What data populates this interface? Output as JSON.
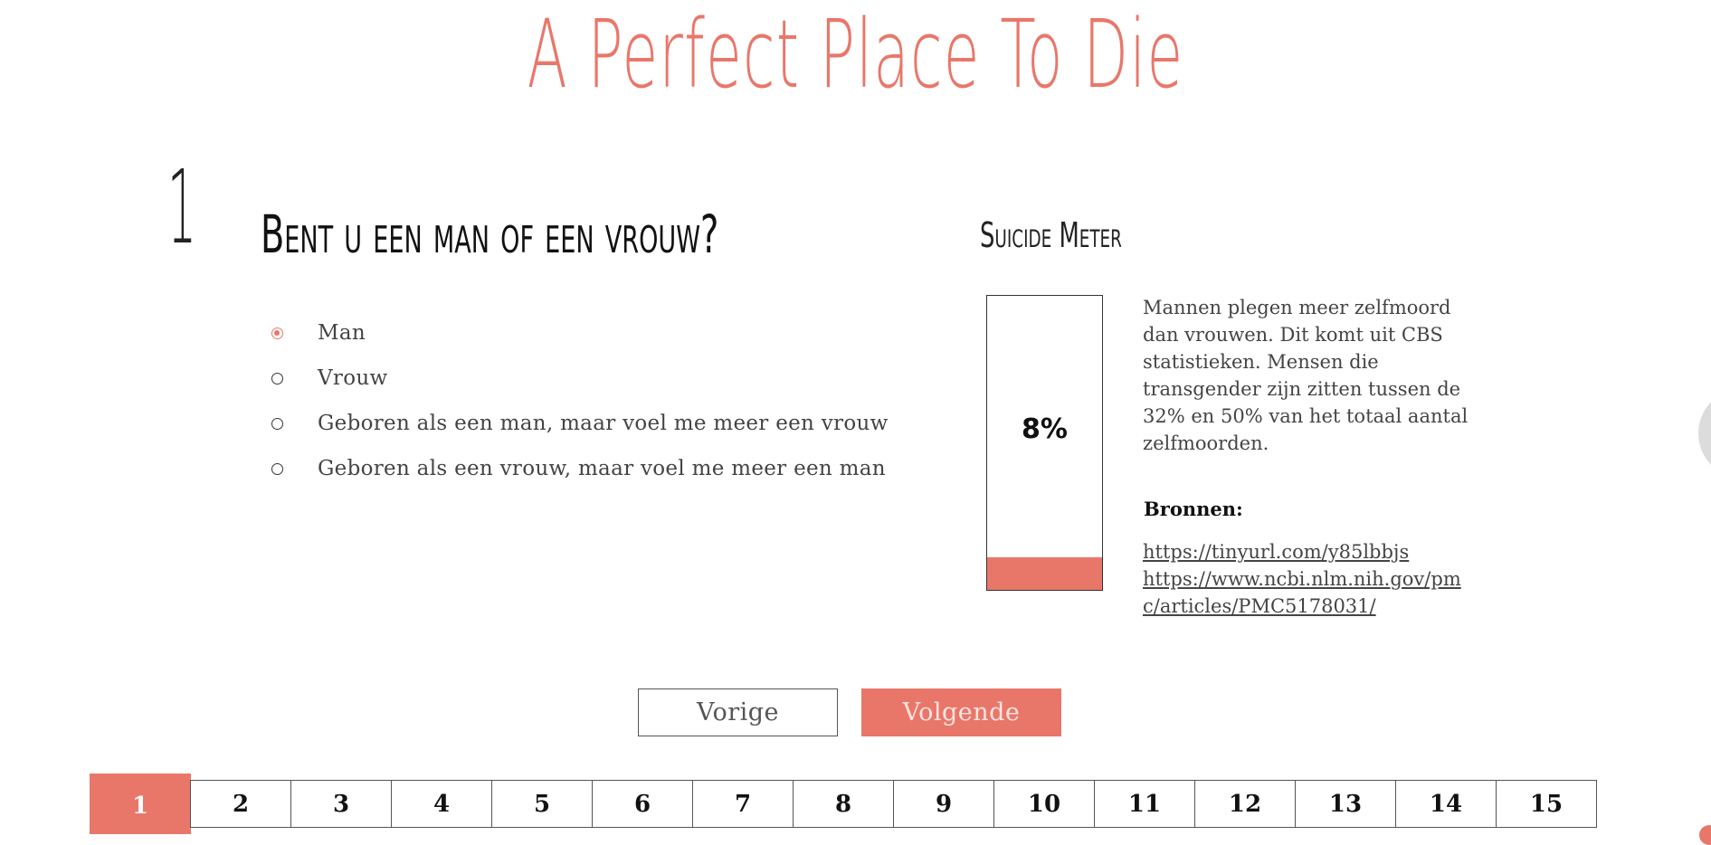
{
  "header": {
    "title": "A Perfect Place To Die"
  },
  "question": {
    "number": "1",
    "text": "Bent u een man of een vrouw?",
    "options": [
      {
        "label": "Man",
        "selected": true
      },
      {
        "label": "Vrouw",
        "selected": false
      },
      {
        "label": "Geboren als een man, maar voel me meer een vrouw",
        "selected": false
      },
      {
        "label": "Geboren als een vrouw, maar voel me meer een man",
        "selected": false
      }
    ]
  },
  "meter": {
    "title": "Suicide Meter",
    "value_label": "8%",
    "fill_fraction": 0.11,
    "color": "#e8776a",
    "explanation": "Mannen plegen meer zelfmoord dan vrouwen. Dit komt uit CBS statistieken. Mensen die transgender zijn zitten tussen de 32% en 50% van het totaal aantal zelfmoorden.",
    "sources_heading": "Bronnen:",
    "sources": [
      "https://tinyurl.com/y85lbbjs",
      "https://www.ncbi.nlm.nih.gov/pmc/articles/PMC5178031/"
    ]
  },
  "navigation": {
    "prev_label": "Vorige",
    "next_label": "Volgende"
  },
  "pager": {
    "active": "1",
    "pages": [
      "1",
      "2",
      "3",
      "4",
      "5",
      "6",
      "7",
      "8",
      "9",
      "10",
      "11",
      "12",
      "13",
      "14",
      "15"
    ]
  },
  "colors": {
    "accent": "#e8776a"
  }
}
